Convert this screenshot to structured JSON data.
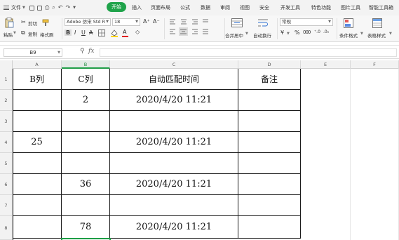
{
  "menubar": {
    "file_label": "文件",
    "tabs": [
      {
        "label": "开始",
        "active": true
      },
      {
        "label": "插入"
      },
      {
        "label": "页面布局"
      },
      {
        "label": "公式"
      },
      {
        "label": "数据"
      },
      {
        "label": "审阅"
      },
      {
        "label": "视图"
      },
      {
        "label": "安全"
      },
      {
        "label": "开发工具"
      },
      {
        "label": "特色功能"
      },
      {
        "label": "图片工具"
      },
      {
        "label": "智能工具箱"
      }
    ]
  },
  "ribbon": {
    "paste_label": "粘贴",
    "cut_label": "剪切",
    "copy_label": "复制",
    "format_painter_label": "格式刷",
    "font_name": "Adobe 仿宋 Std R",
    "font_size": "18",
    "merge_center_label": "合并居中",
    "wrap_text_label": "自动换行",
    "number_format": "常规",
    "conditional_format_label": "条件格式",
    "table_style_label": "表格样式",
    "accent_color": "#1fa34a"
  },
  "formula_bar": {
    "cell_ref": "B9",
    "fx_label": "fx",
    "formula_value": ""
  },
  "sheet": {
    "columns": [
      "A",
      "B",
      "C",
      "D",
      "E",
      "F"
    ],
    "selected_column": "B",
    "rows": [
      "1",
      "2",
      "3",
      "4",
      "5",
      "6",
      "7",
      "8"
    ],
    "header_row": {
      "a": "B列",
      "b": "C列",
      "c": "自动匹配时间",
      "d": "备注"
    },
    "data": [
      {
        "row": "2",
        "a": "",
        "b": "2",
        "c": "2020/4/20 11:21",
        "d": ""
      },
      {
        "row": "3",
        "a": "",
        "b": "",
        "c": "",
        "d": ""
      },
      {
        "row": "4",
        "a": "25",
        "b": "",
        "c": "2020/4/20 11:21",
        "d": ""
      },
      {
        "row": "5",
        "a": "",
        "b": "",
        "c": "",
        "d": ""
      },
      {
        "row": "6",
        "a": "",
        "b": "36",
        "c": "2020/4/20 11:21",
        "d": ""
      },
      {
        "row": "7",
        "a": "",
        "b": "",
        "c": "",
        "d": ""
      },
      {
        "row": "8",
        "a": "",
        "b": "78",
        "c": "2020/4/20 11:21",
        "d": ""
      }
    ]
  }
}
